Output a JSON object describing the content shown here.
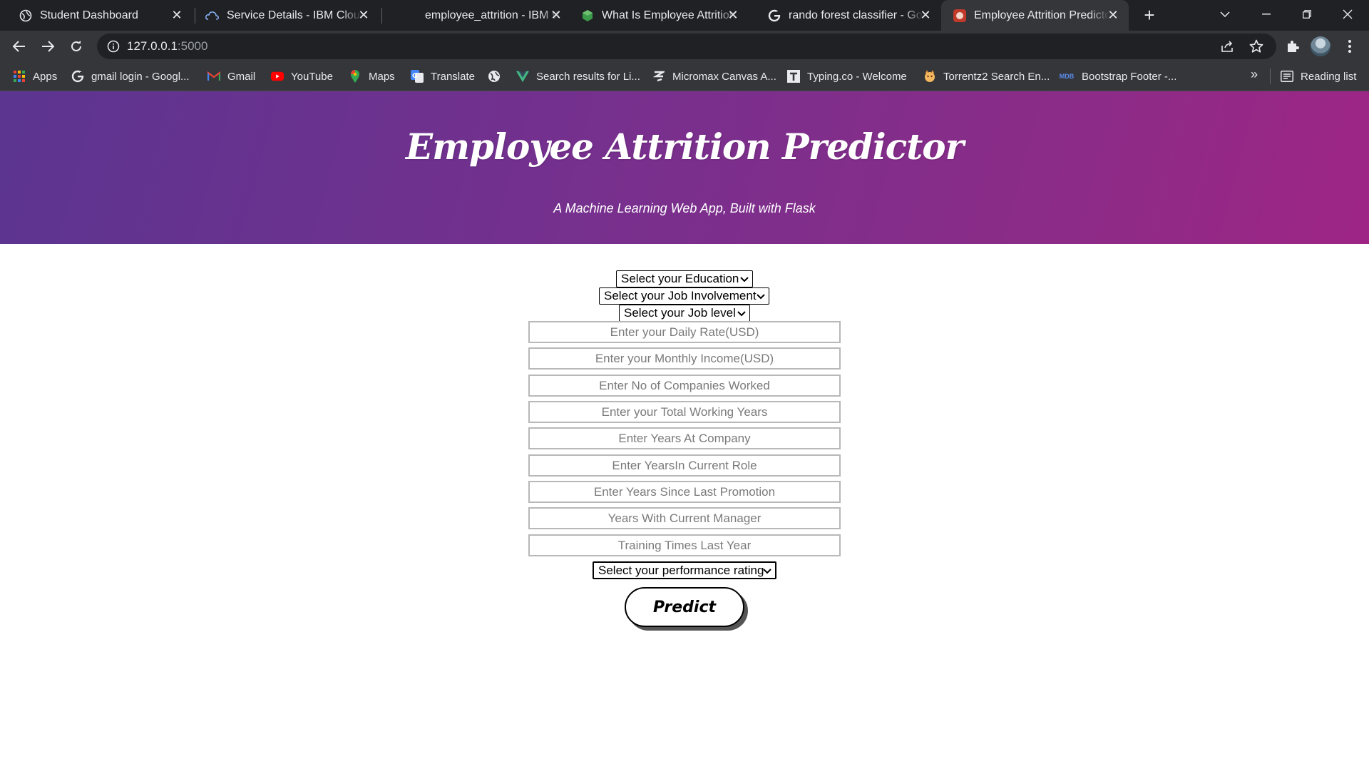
{
  "browser": {
    "tabs": [
      {
        "title": "Student Dashboard",
        "icon": "globe-icon"
      },
      {
        "title": "Service Details - IBM Cloud",
        "icon": "ibm-cloud-icon"
      },
      {
        "title": "employee_attrition - IBM W",
        "icon": "none"
      },
      {
        "title": "What Is Employee Attrition",
        "icon": "cube-icon"
      },
      {
        "title": "rando forest classifier - Goo",
        "icon": "google-icon"
      },
      {
        "title": "Employee Attrition Predicto",
        "icon": "flask-app-icon",
        "active": true
      }
    ],
    "new_tab_label": "+",
    "address": {
      "host": "127.0.0.1",
      "port": ":5000"
    },
    "bookmarks": [
      {
        "label": "Apps",
        "icon": "apps-grid-icon"
      },
      {
        "label": "gmail login - Googl...",
        "icon": "google-icon"
      },
      {
        "label": "Gmail",
        "icon": "gmail-icon"
      },
      {
        "label": "YouTube",
        "icon": "youtube-icon"
      },
      {
        "label": "Maps",
        "icon": "maps-icon"
      },
      {
        "label": "Translate",
        "icon": "translate-icon"
      },
      {
        "label": "",
        "icon": "globe-icon"
      },
      {
        "label": "Search results for Li...",
        "icon": "vue-icon"
      },
      {
        "label": "Micromax Canvas A...",
        "icon": "micromax-icon"
      },
      {
        "label": "Typing.co - Welcome",
        "icon": "typing-icon"
      },
      {
        "label": "Torrentz2 Search En...",
        "icon": "torrentz-icon"
      },
      {
        "label": "Bootstrap Footer -...",
        "icon": "mdb-icon"
      }
    ],
    "more_bookmarks": "»",
    "reading_list": "Reading list"
  },
  "page": {
    "title": "Employee Attrition Predictor",
    "subtitle": "A Machine Learning Web App, Built with Flask",
    "selects": {
      "education": "Select your Education",
      "job_involvement": "Select your Job Involvement",
      "job_level": "Select your Job level",
      "performance_rating": "Select your performance rating"
    },
    "inputs": {
      "daily_rate": "Enter your Daily Rate(USD)",
      "monthly_income": "Enter your Monthly Income(USD)",
      "num_companies": "Enter No of Companies Worked",
      "total_working_years": "Enter your Total Working Years",
      "years_at_company": "Enter Years At Company",
      "years_in_role": "Enter YearsIn Current Role",
      "years_since_promotion": "Enter Years Since Last Promotion",
      "years_with_manager": "Years With Current Manager",
      "training_times": "Training Times Last Year"
    },
    "predict_label": "Predict"
  },
  "colors": {
    "tabstrip": "#202124",
    "toolbar": "#35363a",
    "hero_start": "#5b3590",
    "hero_end": "#9e2585"
  }
}
